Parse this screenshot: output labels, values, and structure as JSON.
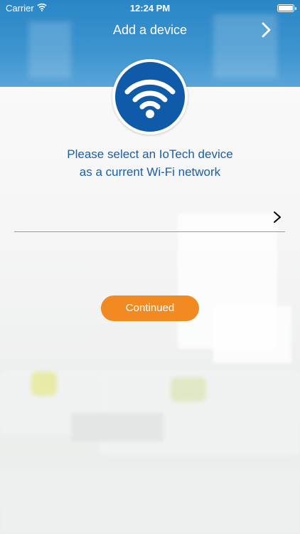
{
  "status_bar": {
    "carrier": "Carrier",
    "time": "12:24 PM",
    "wifi_icon": "wifi-icon",
    "battery_icon": "battery-icon"
  },
  "header": {
    "title": "Add a device",
    "next_icon": "chevron-right-icon",
    "background_color": "#2a86c6"
  },
  "badge": {
    "icon": "wifi-icon",
    "color": "#0f5aa9"
  },
  "prompt": {
    "line1": "Please select an IoTech device",
    "line2": "as a current Wi-Fi network"
  },
  "network_select": {
    "value": "",
    "chevron_icon": "chevron-right-icon"
  },
  "continue_button": {
    "label": "Continued",
    "color": "#f18a21"
  }
}
